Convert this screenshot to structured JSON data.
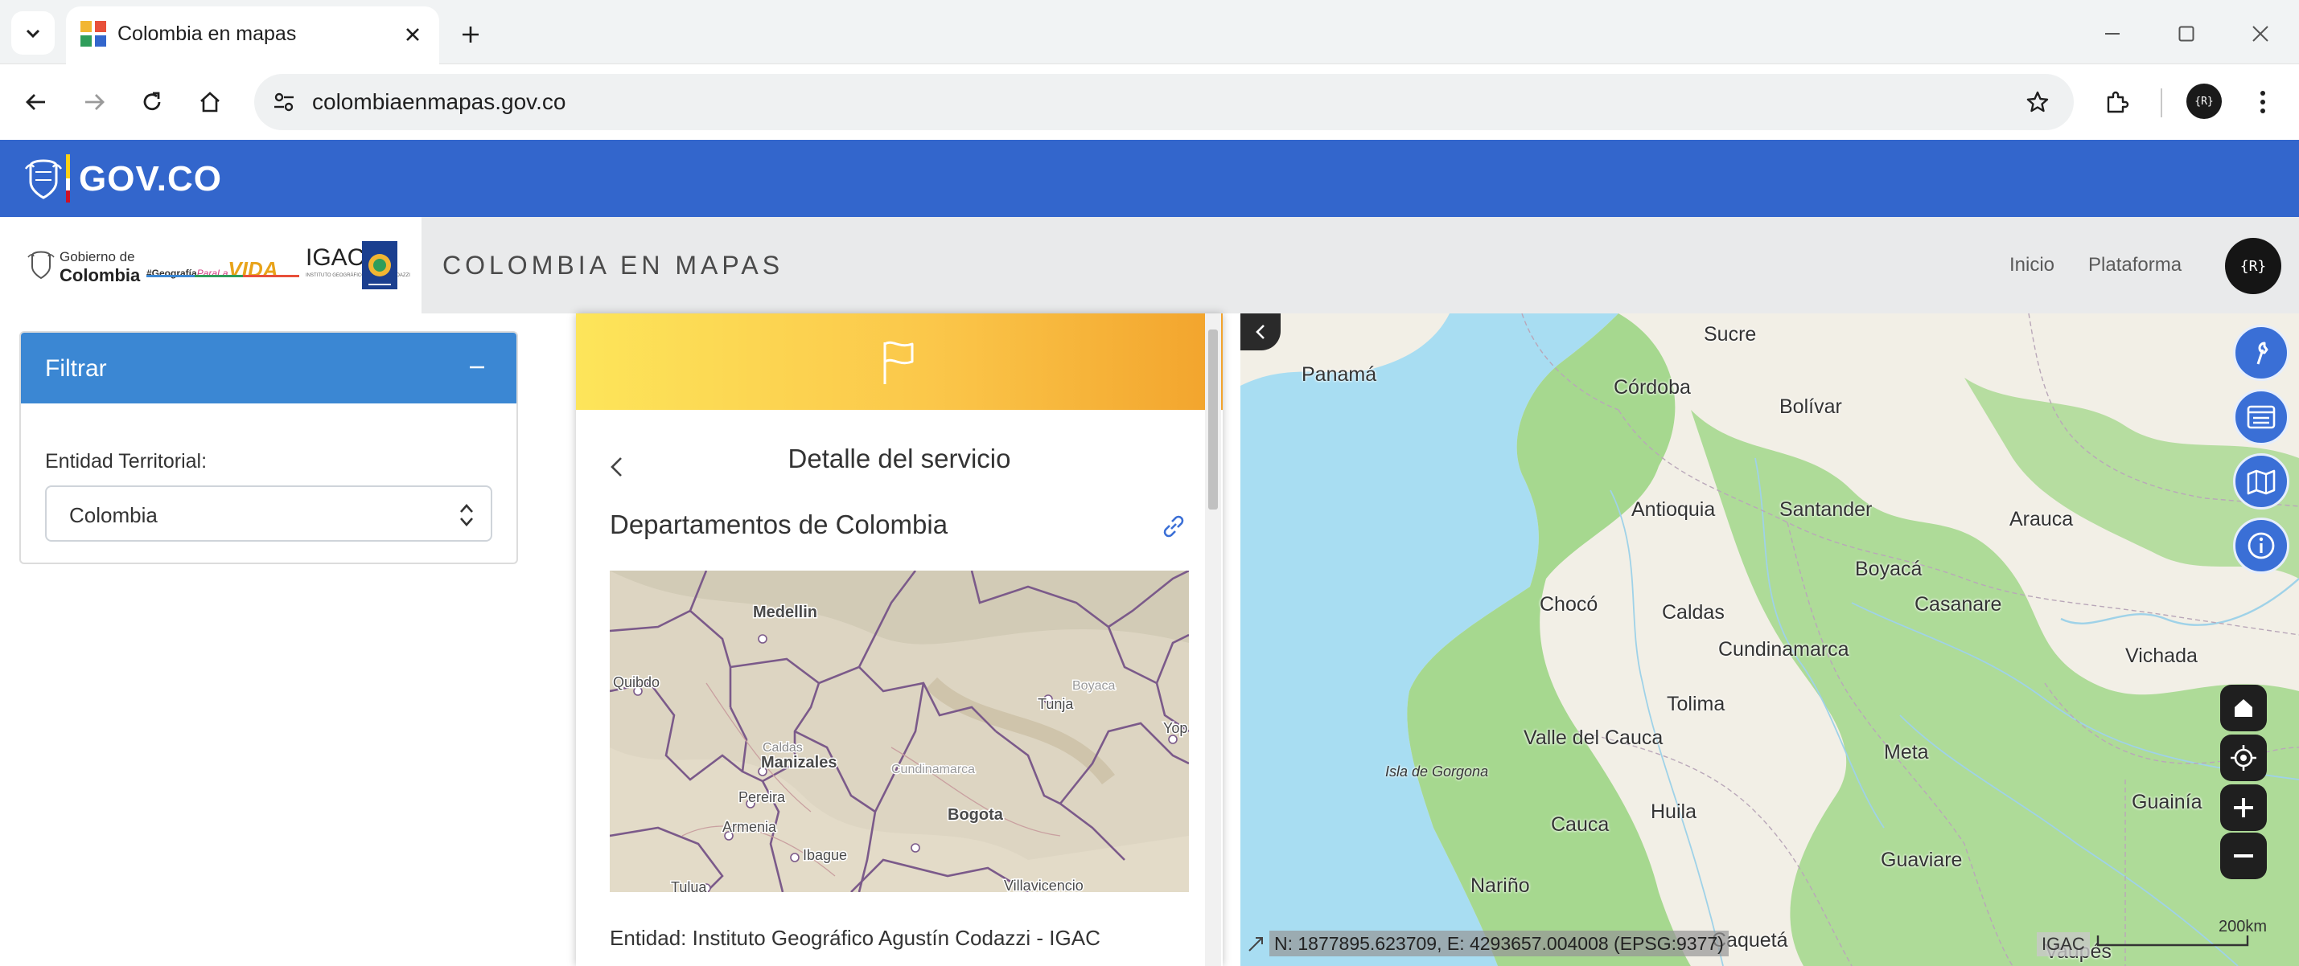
{
  "browser": {
    "tab_title": "Colombia en mapas",
    "url": "colombiaenmapas.gov.co",
    "profile_initials": "{R}"
  },
  "gov_bar": {
    "brand": "GOV.CO"
  },
  "header": {
    "logo_gobierno_line1": "Gobierno de",
    "logo_gobierno_line2": "Colombia",
    "logo_geografia": "#Geografía",
    "logo_para_la": "ParaLa",
    "logo_vida": "VIDA",
    "logo_igac": "IGAC",
    "logo_igac_sub": "INSTITUTO GEOGRÁFICO AGUSTÍN CODAZZI",
    "site_title": "COLOMBIA EN MAPAS",
    "nav": [
      {
        "label": "Inicio"
      },
      {
        "label": "Plataforma"
      }
    ],
    "avatar_initials": "{R}"
  },
  "filter": {
    "title": "Filtrar",
    "field_label": "Entidad Territorial:",
    "selected_value": "Colombia"
  },
  "detail": {
    "heading": "Detalle del servicio",
    "service_name": "Departamentos de Colombia",
    "entity": "Entidad: Instituto Geográfico Agustín Codazzi - IGAC",
    "thumbnail_labels": [
      "Medellin",
      "Quibdo",
      "Caldas",
      "Manizales",
      "Pereira",
      "Armenia",
      "Ibague",
      "Bogota",
      "Tunja",
      "Boyaca",
      "Cundinamarca",
      "Villavicencio",
      "Tulua",
      "Yop"
    ]
  },
  "map": {
    "labels": [
      "Sucre",
      "Panamá",
      "Córdoba",
      "Bolívar",
      "Antioquia",
      "Santander",
      "Arauca",
      "Boyacá",
      "Chocó",
      "Caldas",
      "Casanare",
      "Cundinamarca",
      "Vichada",
      "Tolima",
      "Valle del Cauca",
      "Meta",
      "Isla de Gorgona",
      "Huila",
      "Cauca",
      "Guainía",
      "Guaviare",
      "Nariño",
      "Caquetá",
      "Vaupés"
    ],
    "coordinates": "N: 1877895.623709, E: 4293657.004008 (EPSG:9377)",
    "attribution": "IGAC",
    "scale": "200km"
  },
  "colors": {
    "gov_blue": "#3366cc",
    "filter_header": "#3b87d3",
    "map_tool_blue": "#3a6fd6",
    "band_start": "#fde55a",
    "band_end": "#f2a32c",
    "map_water": "#a8ddf2",
    "map_land": "#f2efe6",
    "map_forest": "#a6d88f"
  },
  "icons": {
    "tab_menu": "chevron-down-icon",
    "tab_close": "close-icon",
    "new_tab": "plus-icon",
    "back": "arrow-left-icon",
    "forward": "arrow-right-icon",
    "reload": "reload-icon",
    "home": "home-icon",
    "site_info": "tune-icon",
    "bookmark": "star-icon",
    "extensions": "puzzle-icon",
    "menu": "kebab-menu-icon",
    "flag": "flag-icon",
    "link": "link-icon",
    "tools": "wrench-icon",
    "layers": "list-panel-icon",
    "maps": "map-icon",
    "info": "info-icon",
    "map_home": "home-icon",
    "locate": "crosshair-icon",
    "zoom_in": "plus-icon",
    "zoom_out": "minus-icon"
  }
}
